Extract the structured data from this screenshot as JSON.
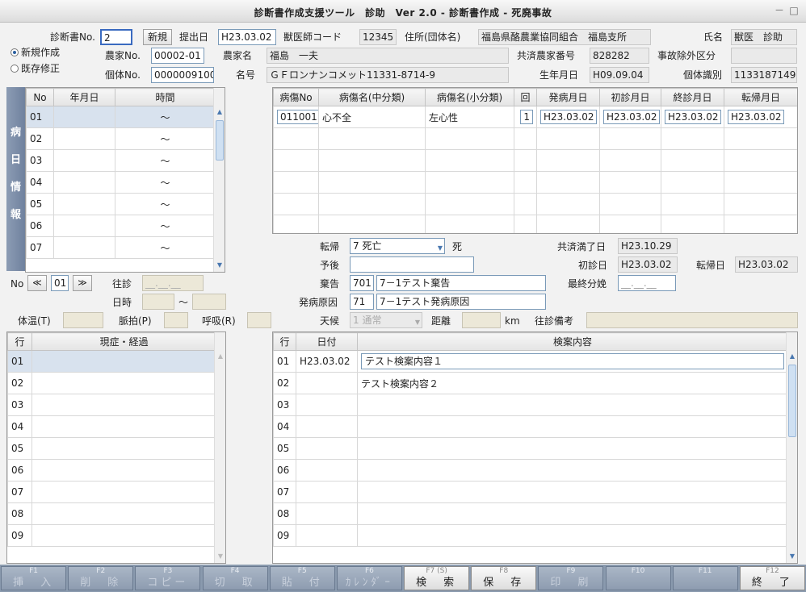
{
  "window": {
    "title": "診断書作成支援ツール　診助　Ver 2.0 - 診断書作成 - 死廃事故",
    "min": "－",
    "max": "□"
  },
  "header": {
    "cert_no_label": "診断書No.",
    "cert_no_value": "2",
    "new_btn": "新規",
    "submit_date_label": "提出日",
    "submit_date": "H23.03.02",
    "vet_code_label": "獣医師コード",
    "vet_code": "12345",
    "address_label": "住所(団体名)",
    "address": "福島県酪農業協同組合　福島支所",
    "name_label": "氏名",
    "name": "獣医　診助",
    "radio_new": "新規作成",
    "radio_edit": "既存修正",
    "farm_no_label": "農家No.",
    "farm_no": "00002-01",
    "farmer_label": "農家名",
    "farmer": "福島　一夫",
    "mutual_no_label": "共済農家番号",
    "mutual_no": "828282",
    "accident_label": "事故除外区分",
    "accident": "",
    "indiv_no_label": "個体No.",
    "indiv_no": "0000009100",
    "animal_name_label": "名号",
    "animal_name": "ＧＦロンナンコメット11331-8714-9",
    "birth_label": "生年月日",
    "birth": "H09.09.04",
    "indiv_id_label": "個体識別",
    "indiv_id": "1133187149"
  },
  "side_label": "病日情報",
  "date_table": {
    "headers": [
      "No",
      "年月日",
      "時間"
    ],
    "rows": [
      {
        "no": "01",
        "date": "",
        "time": "～"
      },
      {
        "no": "02",
        "date": "",
        "time": "～"
      },
      {
        "no": "03",
        "date": "",
        "time": "～"
      },
      {
        "no": "04",
        "date": "",
        "time": "～"
      },
      {
        "no": "05",
        "date": "",
        "time": "～"
      },
      {
        "no": "06",
        "date": "",
        "time": "～"
      },
      {
        "no": "07",
        "date": "",
        "time": "～"
      }
    ]
  },
  "disease_table": {
    "headers": [
      "病傷No",
      "病傷名(中分類)",
      "病傷名(小分類)",
      "回",
      "発病月日",
      "初診月日",
      "終診月日",
      "転帰月日"
    ],
    "rows": [
      {
        "no": "011001",
        "mid": "心不全",
        "small": "左心性",
        "count": "1",
        "onset": "H23.03.02",
        "first": "H23.03.02",
        "last": "H23.03.02",
        "outcome": "H23.03.02"
      }
    ]
  },
  "nav": {
    "no_label": "No",
    "prev": "≪",
    "no_value": "01",
    "next": "≫"
  },
  "visit": {
    "ojin_label": "往診",
    "ojin_value": "__.__.__",
    "datetime_label": "日時",
    "tilde": "～"
  },
  "vitals": {
    "temp_label": "体温(T)",
    "pulse_label": "脈拍(P)",
    "resp_label": "呼吸(R)"
  },
  "outcome": {
    "tenki_label": "転帰",
    "tenki_value": "7 死亡",
    "tenki_text": "死",
    "yogo_label": "予後",
    "zaikoku_label": "棄告",
    "zaikoku_code": "701",
    "zaikoku_text": "7－1テスト棄告",
    "cause_label": "発病原因",
    "cause_code": "71",
    "cause_text": "7－1テスト発病原因",
    "weather_label": "天候",
    "weather_value": "1 通常",
    "distance_label": "距離",
    "km": "km",
    "ojin_note_label": "往診備考",
    "kyosai_end_label": "共済満了日",
    "kyosai_end": "H23.10.29",
    "first_visit_label": "初診日",
    "first_visit": "H23.03.02",
    "tenki_date_label": "転帰日",
    "tenki_date": "H23.03.02",
    "last_birth_label": "最終分娩",
    "last_birth": "__.__.__"
  },
  "progress_table": {
    "headers": [
      "行",
      "現症・経過"
    ],
    "rows": [
      "01",
      "02",
      "03",
      "04",
      "05",
      "06",
      "07",
      "08",
      "09"
    ]
  },
  "exam_table": {
    "headers": [
      "行",
      "日付",
      "検案内容"
    ],
    "rows": [
      {
        "row": "01",
        "date": "H23.03.02",
        "content": "テスト検案内容１"
      },
      {
        "row": "02",
        "date": "",
        "content": "テスト検案内容２"
      },
      {
        "row": "03",
        "date": "",
        "content": ""
      },
      {
        "row": "04",
        "date": "",
        "content": ""
      },
      {
        "row": "05",
        "date": "",
        "content": ""
      },
      {
        "row": "06",
        "date": "",
        "content": ""
      },
      {
        "row": "07",
        "date": "",
        "content": ""
      },
      {
        "row": "08",
        "date": "",
        "content": ""
      },
      {
        "row": "09",
        "date": "",
        "content": ""
      }
    ]
  },
  "fkeys": [
    {
      "key": "F1",
      "label": "挿　入",
      "active": false
    },
    {
      "key": "F2",
      "label": "削　除",
      "active": false
    },
    {
      "key": "F3",
      "label": "コピー",
      "active": false
    },
    {
      "key": "F4",
      "label": "切　取",
      "active": false
    },
    {
      "key": "F5",
      "label": "貼　付",
      "active": false
    },
    {
      "key": "F6",
      "label": "ｶﾚﾝﾀﾞｰ",
      "active": false
    },
    {
      "key": "F7 (S)",
      "label": "検　索",
      "active": true
    },
    {
      "key": "F8",
      "label": "保　存",
      "active": true
    },
    {
      "key": "F9",
      "label": "印　刷",
      "active": false
    },
    {
      "key": "F10",
      "label": "",
      "active": false
    },
    {
      "key": "F11",
      "label": "",
      "active": false
    },
    {
      "key": "F12",
      "label": "終　了",
      "active": true
    }
  ]
}
